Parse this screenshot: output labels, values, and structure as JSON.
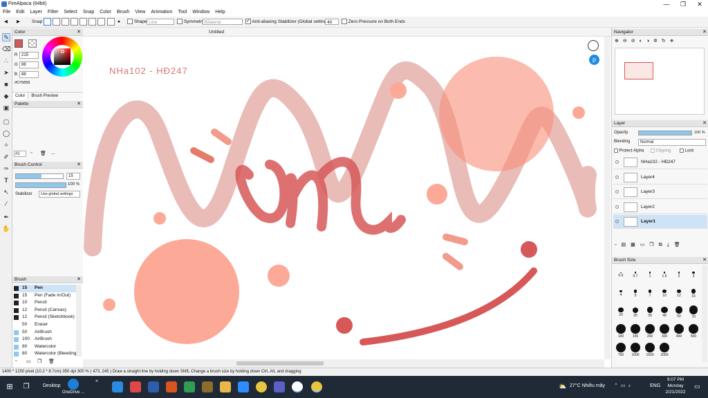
{
  "window": {
    "title": "FireAlpaca (64bit)",
    "minimize": "—",
    "maximize": "❐",
    "close": "✕"
  },
  "menu": [
    "File",
    "Edit",
    "Layer",
    "Filter",
    "Select",
    "Snap",
    "Color",
    "Brush",
    "View",
    "Animation",
    "Tool",
    "Window",
    "Help"
  ],
  "toolbar": {
    "snap_label": "Snap",
    "shape_label": "Shape",
    "shape_value": "Line",
    "symmetry_label": "Symmetry",
    "symmetry_value": "Bilateral",
    "antialias_label": "Anti-aliasing",
    "stabilizer_label": "Stabilizer (Global settings)",
    "stabilizer_value": "40",
    "zero_pressure_label": "Zero Pressure on Both Ends"
  },
  "color": {
    "title": "Color",
    "r_label": "R",
    "r": "215",
    "g_label": "G",
    "g": "88",
    "b_label": "B",
    "b": "88",
    "hex": "#D75858",
    "tab1": "Color",
    "tab2": "Brush Preview",
    "primary": "#d75858"
  },
  "palette": {
    "title": "Palette",
    "selector": "#1"
  },
  "brush_control": {
    "title": "Brush Control",
    "size": "15",
    "opacity": "100 %",
    "size_fill": 0.55,
    "opacity_fill": 1.0,
    "stabilizer_label": "Stabilizer",
    "stabilizer_value": "Use global settings"
  },
  "brush": {
    "title": "Brush",
    "items": [
      {
        "size": "15",
        "name": "Pen",
        "selected": true
      },
      {
        "size": "15",
        "name": "Pen (Fade In/Out)"
      },
      {
        "size": "10",
        "name": "Pencil"
      },
      {
        "size": "12",
        "name": "Pencil (Canvas)"
      },
      {
        "size": "12",
        "name": "Pencil (Sketchbook)"
      },
      {
        "size": "50",
        "name": "Eraser"
      },
      {
        "size": "50",
        "name": "AirBrush"
      },
      {
        "size": "100",
        "name": "AirBrush"
      },
      {
        "size": "80",
        "name": "Watercolor"
      },
      {
        "size": "80",
        "name": "Watercolor (Bleeding)"
      }
    ]
  },
  "document": {
    "tab": "Untitled",
    "canvas_text": "NHa102 - HĐ247"
  },
  "navigator": {
    "title": "Navigator"
  },
  "layer": {
    "title": "Layer",
    "opacity_label": "Opacity",
    "opacity": "100 %",
    "opacity_fill": 1.0,
    "blending_label": "Blending",
    "blending": "Normal",
    "protect_alpha": "Protect Alpha",
    "clipping": "Clipping",
    "lock": "Lock",
    "items": [
      {
        "name": "NHa102 - HĐ247"
      },
      {
        "name": "Layer4"
      },
      {
        "name": "Layer3"
      },
      {
        "name": "Layer2"
      },
      {
        "name": "Layer1",
        "selected": true
      }
    ]
  },
  "brush_size": {
    "title": "Brush Size",
    "values": [
      "0.5",
      "0.7",
      "1",
      "1.5",
      "2",
      "3",
      "4",
      "5",
      "7",
      "10",
      "12",
      "15",
      "20",
      "25",
      "30",
      "40",
      "50",
      "70",
      "100",
      "150",
      "200",
      "300",
      "400",
      "500",
      "700",
      "1000",
      "1500",
      "2000"
    ]
  },
  "status": "1400 * 1200 pixel  (10.2 * 8.7cm)  350 dpi  300 %  ( 473, 245 )  Draw a straight line by holding down Shift, Change a brush size by holding down Ctrl, Alt, and dragging",
  "taskbar": {
    "desktop": "Desktop",
    "onedrive": "OneDrive ...",
    "weather": "27°C  Nhiều mây",
    "lang": "ENG",
    "time": "9:07 PM",
    "day": "Monday",
    "date": "2/21/2022"
  }
}
